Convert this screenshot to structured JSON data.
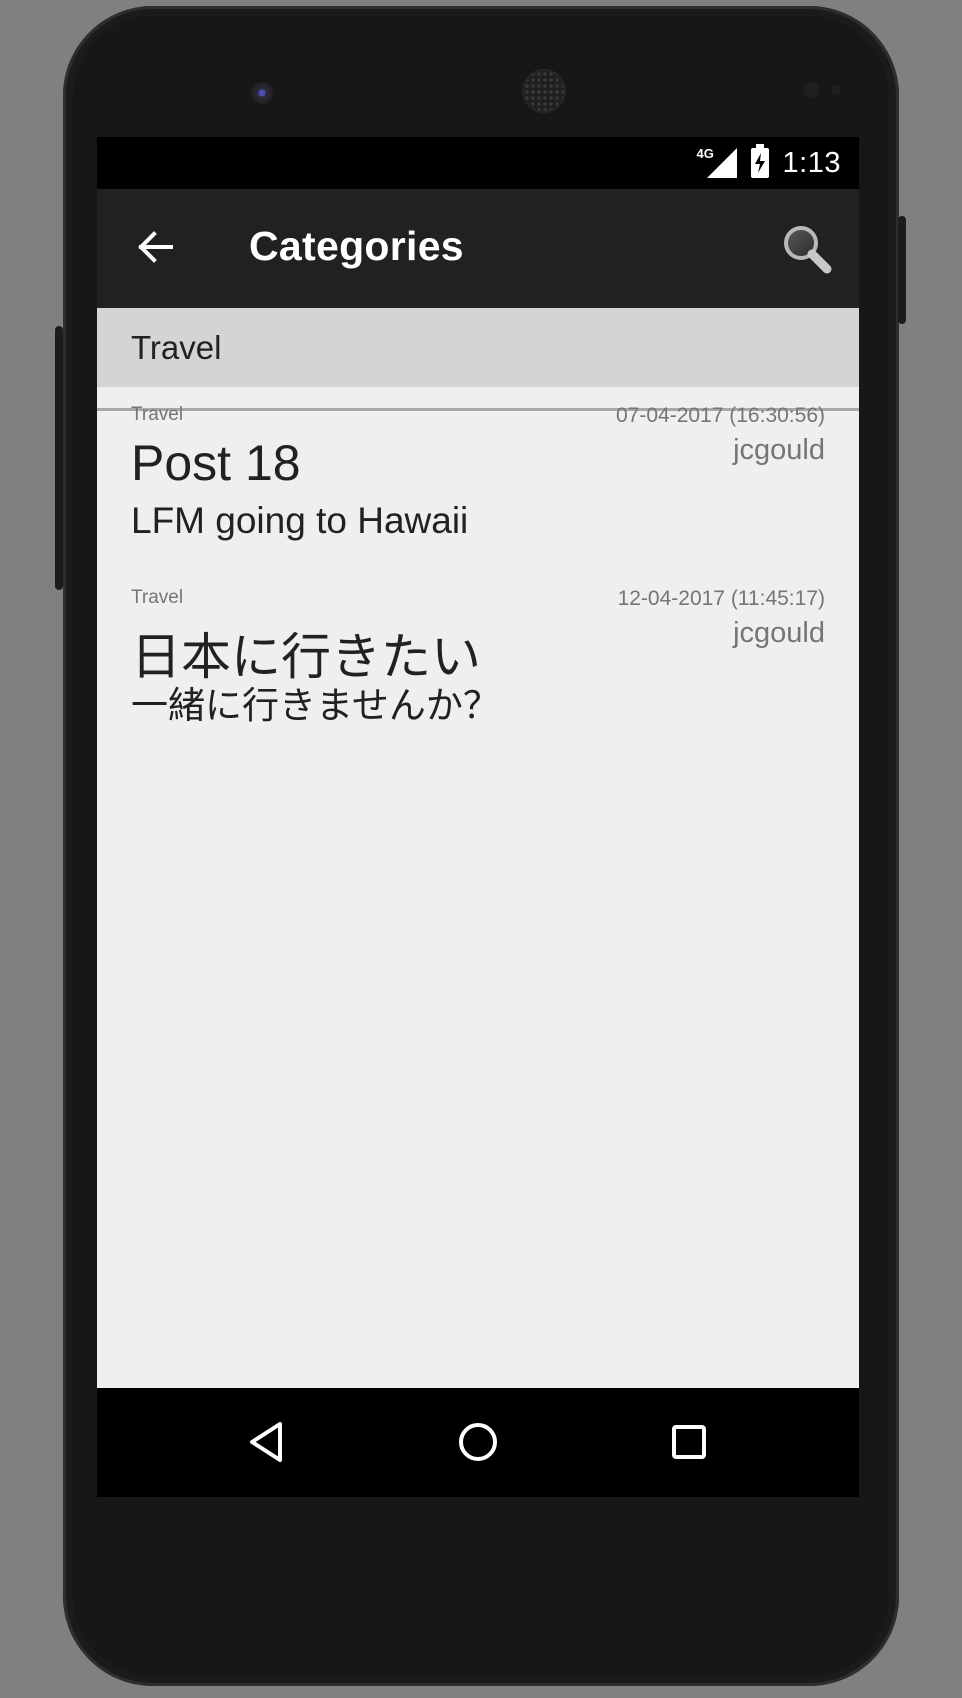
{
  "status_bar": {
    "network": "4G",
    "time": "1:13",
    "icons": [
      "signal-icon",
      "battery-charging-icon"
    ]
  },
  "app_bar": {
    "title": "Categories",
    "icons": [
      "back-arrow-icon",
      "search-icon"
    ]
  },
  "section": {
    "header": "Travel"
  },
  "posts": [
    {
      "category": "Travel",
      "date": "07-04-2017 (16:30:56)",
      "author": "jcgould",
      "title": "Post 18",
      "body": "LFM going to Hawaii"
    },
    {
      "category": "Travel",
      "date": "12-04-2017 (11:45:17)",
      "author": "jcgould",
      "title": "日本に行きたい",
      "body": "一緒に行きませんか？"
    }
  ],
  "nav_bar": {
    "icons": [
      "back-triangle-icon",
      "home-circle-icon",
      "recents-square-icon"
    ]
  },
  "colors": {
    "app_bar": "#212121",
    "content_bg": "#efefef",
    "section_header_bg": "#d4d4d4",
    "secondary_text": "#757575",
    "primary_text": "#212121"
  }
}
